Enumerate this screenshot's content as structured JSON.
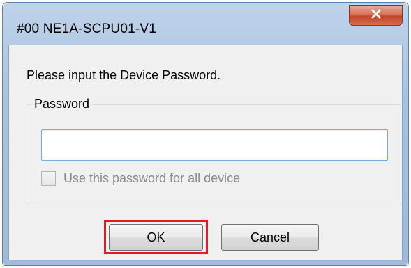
{
  "window": {
    "title": "#00 NE1A-SCPU01-V1",
    "close_icon": "close-x-icon"
  },
  "dialog": {
    "prompt": "Please input the Device Password.",
    "group_label": "Password",
    "password_value": "",
    "checkbox_label": "Use this password for all device",
    "checkbox_checked": false,
    "checkbox_enabled": false
  },
  "buttons": {
    "ok_label": "OK",
    "cancel_label": "Cancel"
  },
  "colors": {
    "highlight": "#e01c23",
    "close_button": "#c2452a"
  }
}
